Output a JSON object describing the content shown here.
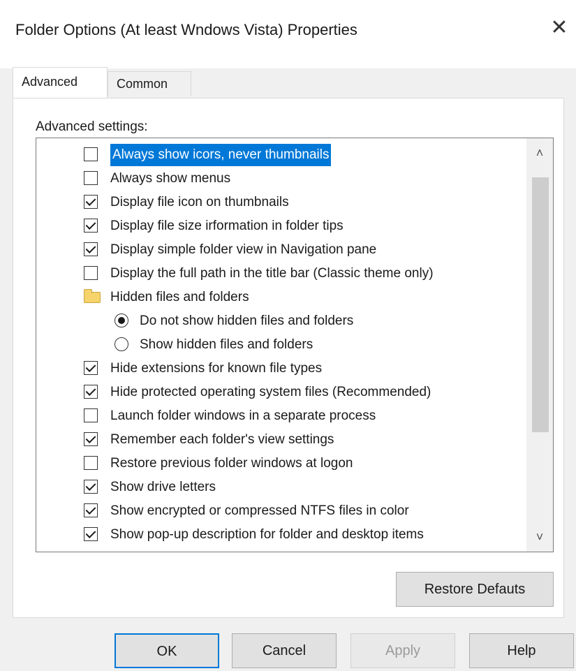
{
  "window": {
    "title": "Folder Options (At least Wndows Vista) Properties",
    "close_glyph": "✕"
  },
  "tabs": [
    {
      "label": "Advanced",
      "active": true
    },
    {
      "label": "Common",
      "active": false
    }
  ],
  "advanced": {
    "section_label": "Advanced settings:",
    "items": [
      {
        "type": "checkbox",
        "checked": false,
        "label": "Always show icors, never thumbnails",
        "selected": true
      },
      {
        "type": "checkbox",
        "checked": false,
        "label": "Always show menus"
      },
      {
        "type": "checkbox",
        "checked": true,
        "label": "Display file icon on thumbnails"
      },
      {
        "type": "checkbox",
        "checked": true,
        "label": "Display file size irformation in folder tips"
      },
      {
        "type": "checkbox",
        "checked": true,
        "label": "Display simple folder view in Navigation pane"
      },
      {
        "type": "checkbox",
        "checked": false,
        "label": "Display the full path in the title bar (Classic theme only)"
      },
      {
        "type": "folder",
        "icon": "folder-icon",
        "label": "Hidden files and folders"
      },
      {
        "type": "radio",
        "selected": true,
        "label": "Do not show hidden files and folders"
      },
      {
        "type": "radio",
        "selected": false,
        "label": "Show hidden files and folders"
      },
      {
        "type": "checkbox",
        "checked": true,
        "label": "Hide extensions for known file types"
      },
      {
        "type": "checkbox",
        "checked": true,
        "label": "Hide protected operating system files (Recommended)"
      },
      {
        "type": "checkbox",
        "checked": false,
        "label": "Launch folder windows in a separate process"
      },
      {
        "type": "checkbox",
        "checked": true,
        "label": "Remember each folder's view settings"
      },
      {
        "type": "checkbox",
        "checked": false,
        "label": "Restore previous folder windows at logon"
      },
      {
        "type": "checkbox",
        "checked": true,
        "label": "Show drive letters"
      },
      {
        "type": "checkbox",
        "checked": true,
        "label": "Show encrypted or compressed NTFS files in color"
      },
      {
        "type": "checkbox",
        "checked": true,
        "label": "Show pop-up description for folder and desktop items"
      }
    ],
    "scroll_up_glyph": "˄",
    "scroll_down_glyph": "˅",
    "restore_defaults_label": "Restore Defauts"
  },
  "buttons": {
    "ok": "OK",
    "cancel": "Cancel",
    "apply": "Apply",
    "help": "Help"
  },
  "colors": {
    "selection": "#0078d7",
    "folder": "#f6d36b"
  }
}
